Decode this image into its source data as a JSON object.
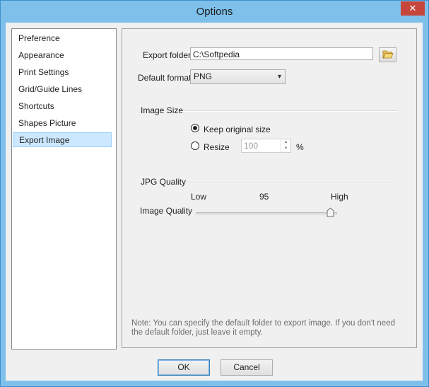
{
  "window": {
    "title": "Options",
    "close_glyph": "✕"
  },
  "sidebar": {
    "items": [
      {
        "label": "Preference"
      },
      {
        "label": "Appearance"
      },
      {
        "label": "Print Settings"
      },
      {
        "label": "Grid/Guide Lines"
      },
      {
        "label": "Shortcuts"
      },
      {
        "label": "Shapes Picture"
      },
      {
        "label": "Export Image",
        "selected": true
      }
    ]
  },
  "export": {
    "folder_label": "Export folder",
    "folder_value": "C:\\Softpedia",
    "folder_button_icon": "folder-open-icon",
    "format_label": "Default format",
    "format_value": "PNG",
    "format_chevron": "▾"
  },
  "image_size": {
    "group_label": "Image Size",
    "keep_original_label": "Keep original size",
    "keep_original_selected": true,
    "resize_label": "Resize",
    "resize_selected": false,
    "resize_value": "100",
    "resize_unit": "%",
    "spin_up": "▲",
    "spin_down": "▼"
  },
  "jpg_quality": {
    "group_label": "JPG Quality",
    "low_label": "Low",
    "value": "95",
    "high_label": "High",
    "image_quality_label": "Image Quality",
    "slider_fraction": 0.95
  },
  "note": "Note: You can specify the default folder to export image. If you don't need the default folder, just leave it empty.",
  "buttons": {
    "ok": "OK",
    "cancel": "Cancel"
  },
  "colors": {
    "titlebar": "#7fc0ea",
    "close": "#c7463b",
    "selected": "#cce8ff"
  }
}
